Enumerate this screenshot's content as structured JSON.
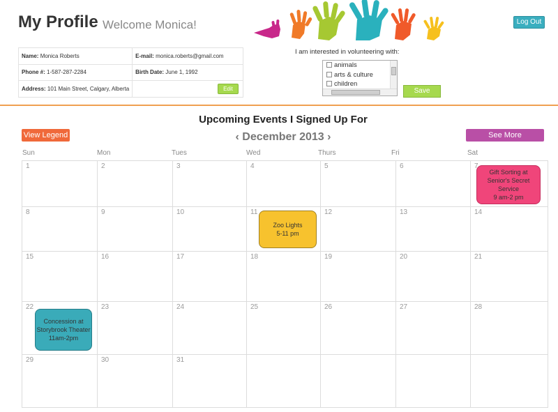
{
  "header": {
    "title": "My Profile",
    "welcome": "Welcome Monica!",
    "logout_label": "Log Out"
  },
  "profile": {
    "name_label": "Name:",
    "name": "Monica Roberts",
    "email_label": "E-mail:",
    "email": "monica.roberts@gmail.com",
    "phone_label": "Phone #:",
    "phone": "1-587-287-2284",
    "birth_label": "Birth Date:",
    "birth": "June 1, 1992",
    "address_label": "Address:",
    "address": "101 Main Street, Calgary, Alberta",
    "edit_label": "Edit"
  },
  "interests": {
    "label": "I am interested in volunteering with:",
    "options": [
      "animals",
      "arts & culture",
      "children"
    ],
    "save_label": "Save"
  },
  "calendar": {
    "section_title": "Upcoming Events I Signed Up For",
    "legend_label": "View Legend",
    "month": "December 2013",
    "prev_icon": "‹",
    "next_icon": "›",
    "more_label": "See More Opportunities",
    "days_of_week": [
      "Sun",
      "Mon",
      "Tues",
      "Wed",
      "Thurs",
      "Fri",
      "Sat"
    ],
    "weeks": [
      [
        "1",
        "2",
        "3",
        "4",
        "5",
        "6",
        "7"
      ],
      [
        "8",
        "9",
        "10",
        "11",
        "12",
        "13",
        "14"
      ],
      [
        "15",
        "16",
        "17",
        "18",
        "19",
        "20",
        "21"
      ],
      [
        "22",
        "23",
        "24",
        "25",
        "26",
        "27",
        "28"
      ],
      [
        "29",
        "30",
        "31",
        "",
        "",
        "",
        ""
      ]
    ],
    "events": [
      {
        "text": "Gift Sorting at\nSenior's Secret\nService\n9 am-2 pm",
        "color": "#f0457a"
      },
      {
        "text": "Zoo Lights\n5-11 pm",
        "color": "#f7c22e"
      },
      {
        "text": "Concession at\nStorybrook Theater\n11am-2pm",
        "color": "#3aabb9"
      }
    ]
  }
}
